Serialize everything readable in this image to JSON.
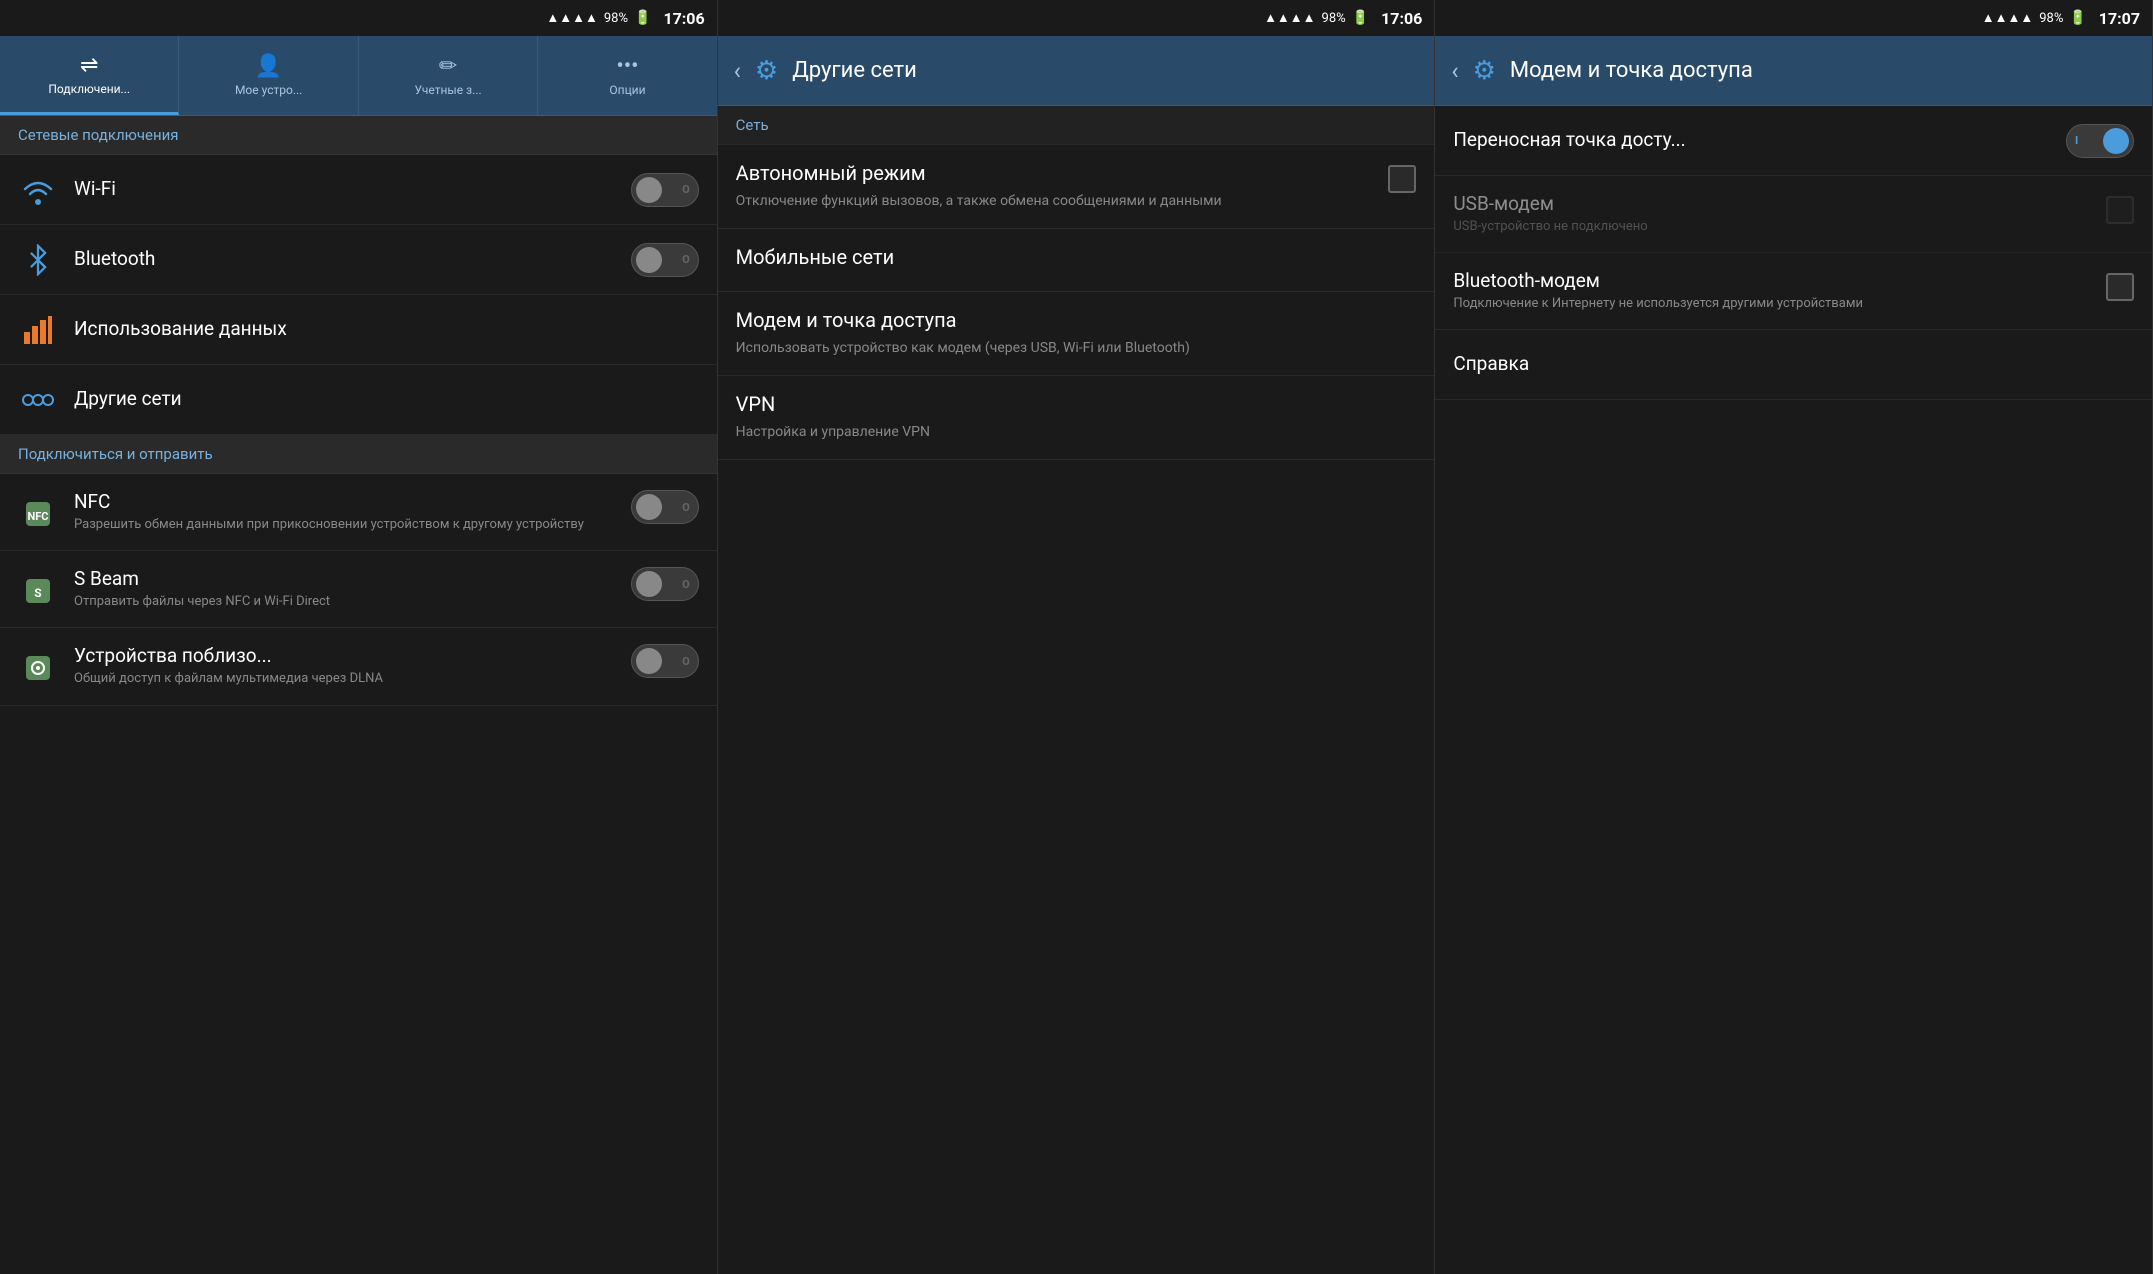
{
  "panels": [
    {
      "id": "panel1",
      "statusBar": {
        "signal": "▲▲▲▲",
        "battery": "98%",
        "batteryIcon": "🔋",
        "time": "17:06"
      },
      "navTabs": [
        {
          "id": "connections",
          "icon": "⇌",
          "label": "Подключени...",
          "active": true
        },
        {
          "id": "mydevice",
          "icon": "👤",
          "label": "Мое устро...",
          "active": false
        },
        {
          "id": "accounts",
          "icon": "✏",
          "label": "Учетные з...",
          "active": false
        },
        {
          "id": "options",
          "icon": "•••",
          "label": "Опции",
          "active": false
        }
      ],
      "sectionHeader": "Сетевые подключения",
      "items": [
        {
          "id": "wifi",
          "icon": "wifi",
          "title": "Wi-Fi",
          "subtitle": "",
          "toggle": true,
          "toggleOn": false
        },
        {
          "id": "bluetooth",
          "icon": "bt",
          "title": "Bluetooth",
          "subtitle": "",
          "toggle": true,
          "toggleOn": false
        }
      ],
      "items2": [
        {
          "id": "datausage",
          "icon": "data",
          "title": "Использование данных",
          "subtitle": "",
          "toggle": false
        },
        {
          "id": "othernets",
          "icon": "net",
          "title": "Другие сети",
          "subtitle": "",
          "toggle": false
        }
      ],
      "sectionHeader2": "Подключиться и отправить",
      "items3": [
        {
          "id": "nfc",
          "icon": "nfc",
          "title": "NFC",
          "subtitle": "Разрешить обмен данными при прикосновении устройством к другому устройству",
          "toggle": true,
          "toggleOn": false
        },
        {
          "id": "sbeam",
          "icon": "sbeam",
          "title": "S Beam",
          "subtitle": "Отправить файлы через NFC и Wi-Fi Direct",
          "toggle": true,
          "toggleOn": false
        },
        {
          "id": "nearbydevices",
          "icon": "dlna",
          "title": "Устройства поблизо...",
          "subtitle": "Общий доступ к файлам мультимедиа через DLNA",
          "toggle": true,
          "toggleOn": false
        }
      ]
    },
    {
      "id": "panel2",
      "statusBar": {
        "signal": "▲▲▲▲",
        "battery": "98%",
        "batteryIcon": "🔋",
        "time": "17:06"
      },
      "header": {
        "title": "Другие сети",
        "hasBack": true,
        "hasGear": true
      },
      "divider": "Сеть",
      "items": [
        {
          "id": "airplane",
          "title": "Автономный режим",
          "desc": "Отключение функций вызовов, а также обмена сообщениями и данными",
          "hasCheckbox": true
        },
        {
          "id": "mobilenets",
          "title": "Мобильные сети",
          "desc": "",
          "hasCheckbox": false
        },
        {
          "id": "modemhotspot",
          "title": "Модем и точка доступа",
          "desc": "Использовать устройство как модем (через USB, Wi-Fi или Bluetooth)",
          "hasCheckbox": false
        },
        {
          "id": "vpn",
          "title": "VPN",
          "desc": "Настройка и управление VPN",
          "hasCheckbox": false
        }
      ]
    },
    {
      "id": "panel3",
      "statusBar": {
        "signal": "▲▲▲▲",
        "battery": "98%",
        "batteryIcon": "🔋",
        "time": "17:07"
      },
      "header": {
        "title": "Модем и точка доступа",
        "hasBack": true,
        "hasGear": true
      },
      "items": [
        {
          "id": "hotspot",
          "title": "Переносная точка досту...",
          "desc": "",
          "toggle": true,
          "toggleOn": true,
          "hasCheckbox": false
        },
        {
          "id": "usbmodem",
          "title": "USB-модем",
          "desc": "USB-устройство не подключено",
          "toggle": false,
          "toggleOn": false,
          "hasCheckbox": true,
          "disabled": true
        },
        {
          "id": "btmodem",
          "title": "Bluetooth-модем",
          "desc": "Подключение к Интернету не используется другими устройствами",
          "toggle": false,
          "toggleOn": false,
          "hasCheckbox": true,
          "disabled": false
        },
        {
          "id": "help",
          "title": "Справка",
          "desc": "",
          "toggle": false,
          "hasCheckbox": false
        }
      ]
    }
  ]
}
